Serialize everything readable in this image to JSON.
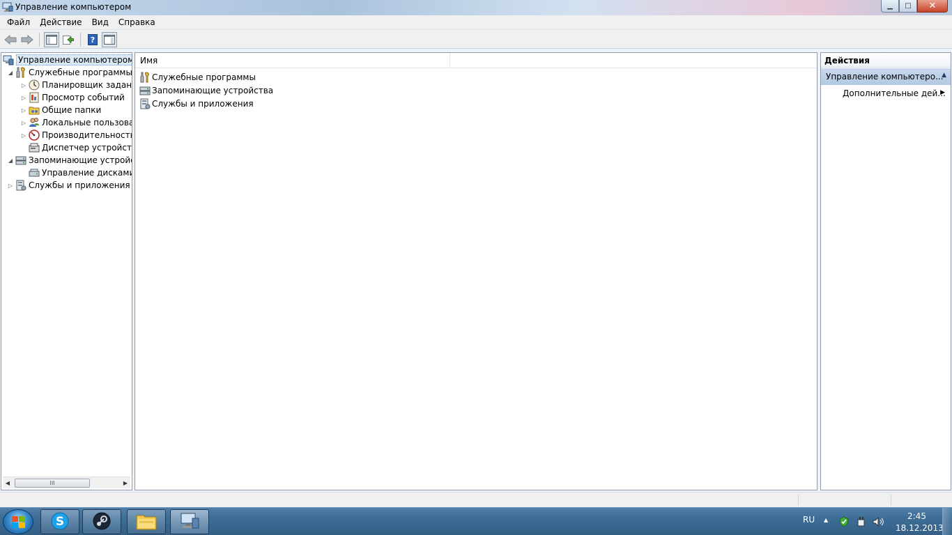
{
  "window": {
    "title": "Управление компьютером",
    "minimize": "▁",
    "maximize": "□",
    "close": "✕"
  },
  "menu": [
    "Файл",
    "Действие",
    "Вид",
    "Справка"
  ],
  "toolbar": [
    "back-icon",
    "forward-icon",
    "show-hide-tree-icon",
    "export-list-icon",
    "help-icon",
    "show-hide-action-pane-icon"
  ],
  "tree": {
    "root": "Управление компьютером (л",
    "items": [
      {
        "label": "Служебные программы",
        "expander": "◢"
      },
      {
        "label": "Планировщик заданий",
        "expander": "▷"
      },
      {
        "label": "Просмотр событий",
        "expander": "▷"
      },
      {
        "label": "Общие папки",
        "expander": "▷"
      },
      {
        "label": "Локальные пользовате",
        "expander": "▷"
      },
      {
        "label": "Производительность",
        "expander": "▷"
      },
      {
        "label": "Диспетчер устройств",
        "expander": ""
      },
      {
        "label": "Запоминающие устройст",
        "expander": "◢"
      },
      {
        "label": "Управление дисками",
        "expander": ""
      },
      {
        "label": "Службы и приложения",
        "expander": "▷"
      }
    ],
    "scroll_left": "◀",
    "scroll_right": "▶",
    "scroll_grip": "III"
  },
  "content": {
    "column_name": "Имя",
    "rows": [
      "Служебные программы",
      "Запоминающие устройства",
      "Службы и приложения"
    ]
  },
  "actions": {
    "header": "Действия",
    "section": "Управление компьютеро...",
    "section_arrow": "▲",
    "item": "Дополнительные дей...",
    "item_arrow": "▶"
  },
  "taskbar": {
    "apps": [
      "skype-icon",
      "steam-icon",
      "explorer-icon",
      "computer-management-icon"
    ],
    "language": "RU",
    "tray_arrow": "▲",
    "time": "2:45",
    "date": "18.12.2013"
  }
}
